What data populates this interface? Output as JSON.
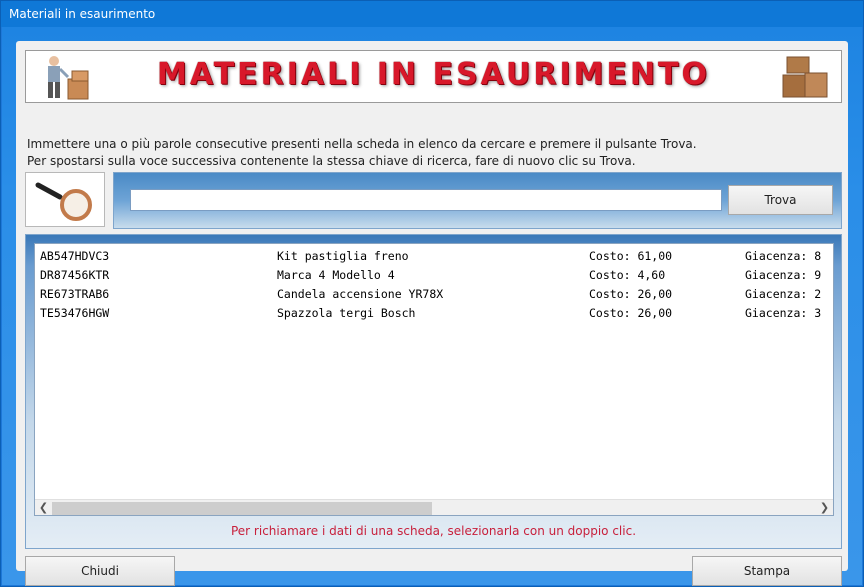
{
  "window": {
    "title": "Materiali in esaurimento"
  },
  "banner": {
    "title": "MATERIALI IN ESAURIMENTO"
  },
  "instructions": {
    "line1": "Immettere una o più parole consecutive presenti nella scheda in elenco da cercare e premere il pulsante Trova.",
    "line2": "Per spostarsi sulla voce successiva contenente la stessa chiave di ricerca, fare di nuovo clic su Trova."
  },
  "search": {
    "value": "",
    "button_label": "Trova"
  },
  "list": {
    "rows": [
      {
        "code": "AB547HDVC3",
        "description": "Kit pastiglia freno",
        "cost": "Costo: 61,00",
        "stock": "Giacenza: 8"
      },
      {
        "code": "DR87456KTR",
        "description": "Marca 4 Modello 4",
        "cost": "Costo: 4,60",
        "stock": "Giacenza: 9"
      },
      {
        "code": "RE673TRAB6",
        "description": "Candela accensione YR78X",
        "cost": "Costo: 26,00",
        "stock": "Giacenza: 2"
      },
      {
        "code": "TE53476HGW",
        "description": "Spazzola tergi Bosch",
        "cost": "Costo: 26,00",
        "stock": "Giacenza: 3"
      }
    ]
  },
  "hint": "Per richiamare i dati di una scheda, selezionarla con un doppio clic.",
  "buttons": {
    "close": "Chiudi",
    "print": "Stampa"
  },
  "icons": {
    "person": "delivery-person-icon",
    "boxes": "boxes-icon",
    "search": "magnifier-icon"
  },
  "colors": {
    "titlebar": "#0f78d7",
    "hint": "#c8203c",
    "banner_title": "#d8182a"
  }
}
